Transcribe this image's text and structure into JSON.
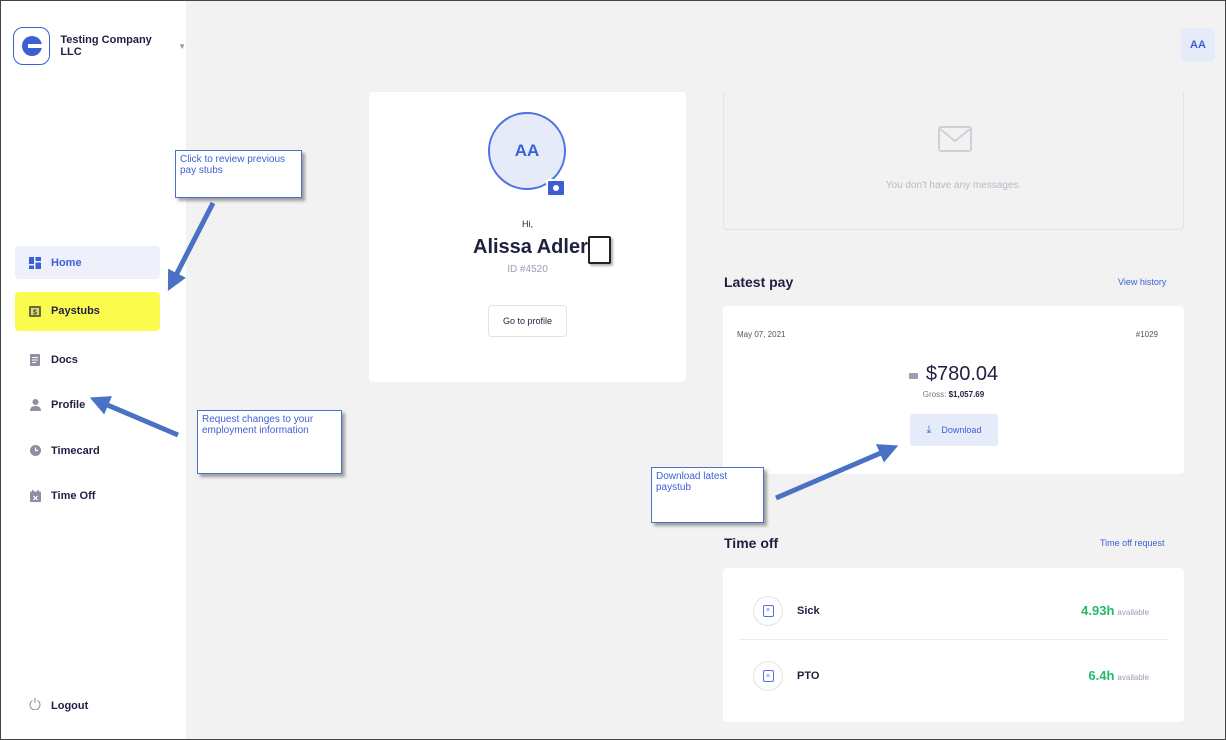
{
  "company": {
    "name": "Testing Company LLC"
  },
  "header": {
    "avatar_initials": "AA"
  },
  "sidebar": {
    "items": [
      {
        "label": "Home",
        "icon": "dashboard-icon"
      },
      {
        "label": "Paystubs",
        "icon": "paystub-icon"
      },
      {
        "label": "Docs",
        "icon": "document-icon"
      },
      {
        "label": "Profile",
        "icon": "user-icon"
      },
      {
        "label": "Timecard",
        "icon": "clock-icon"
      },
      {
        "label": "Time Off",
        "icon": "calendar-icon"
      }
    ],
    "logout_label": "Logout"
  },
  "profile": {
    "initials": "AA",
    "greeting": "Hi,",
    "name": "Alissa Adler",
    "id": "ID #4520",
    "button": "Go to profile"
  },
  "messages": {
    "empty_text": "You don't have any messages."
  },
  "latest_pay": {
    "title": "Latest pay",
    "link": "View history",
    "date": "May 07, 2021",
    "number": "#1029",
    "net": "$780.04",
    "gross_label": "Gross:",
    "gross_value": "$1,057.69",
    "download": "Download"
  },
  "time_off": {
    "title": "Time off",
    "link": "Time off request",
    "rows": [
      {
        "label": "Sick",
        "hours": "4.93h",
        "suffix": "available"
      },
      {
        "label": "PTO",
        "hours": "6.4h",
        "suffix": "available"
      }
    ]
  },
  "annotations": {
    "paystubs_note": "Click to review previous pay stubs",
    "profile_note": "Request changes to your employment information",
    "download_note": "Download latest paystub"
  },
  "colors": {
    "accent": "#3d5fd6",
    "highlight": "#fbfb4d",
    "available_green": "#25b869",
    "background": "#f2f2f3"
  }
}
